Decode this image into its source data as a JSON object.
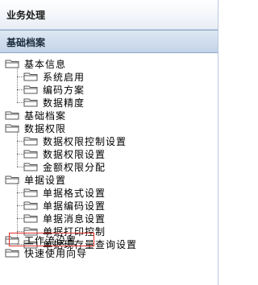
{
  "header": {
    "title": "业务处理"
  },
  "section": {
    "title": "基础档案"
  },
  "tree": [
    {
      "label": "基本信息",
      "children": [
        "系统启用",
        "编码方案",
        "数据精度"
      ]
    },
    {
      "label": "基础档案",
      "children": []
    },
    {
      "label": "数据权限",
      "children": [
        "数据权限控制设置",
        "数据权限设置",
        "金额权限分配"
      ]
    },
    {
      "label": "单据设置",
      "children": [
        "单据格式设置",
        "单据编码设置",
        "单据消息设置",
        "单据打印控制",
        "单据现存量查询设置"
      ]
    },
    {
      "label": "工作流设置",
      "children": [],
      "highlighted": true
    },
    {
      "label": "快速使用向导",
      "children": []
    }
  ],
  "colors": {
    "highlight_border": "#e0302a",
    "folder_fill": "#ffffff",
    "folder_stroke": "#555555"
  }
}
